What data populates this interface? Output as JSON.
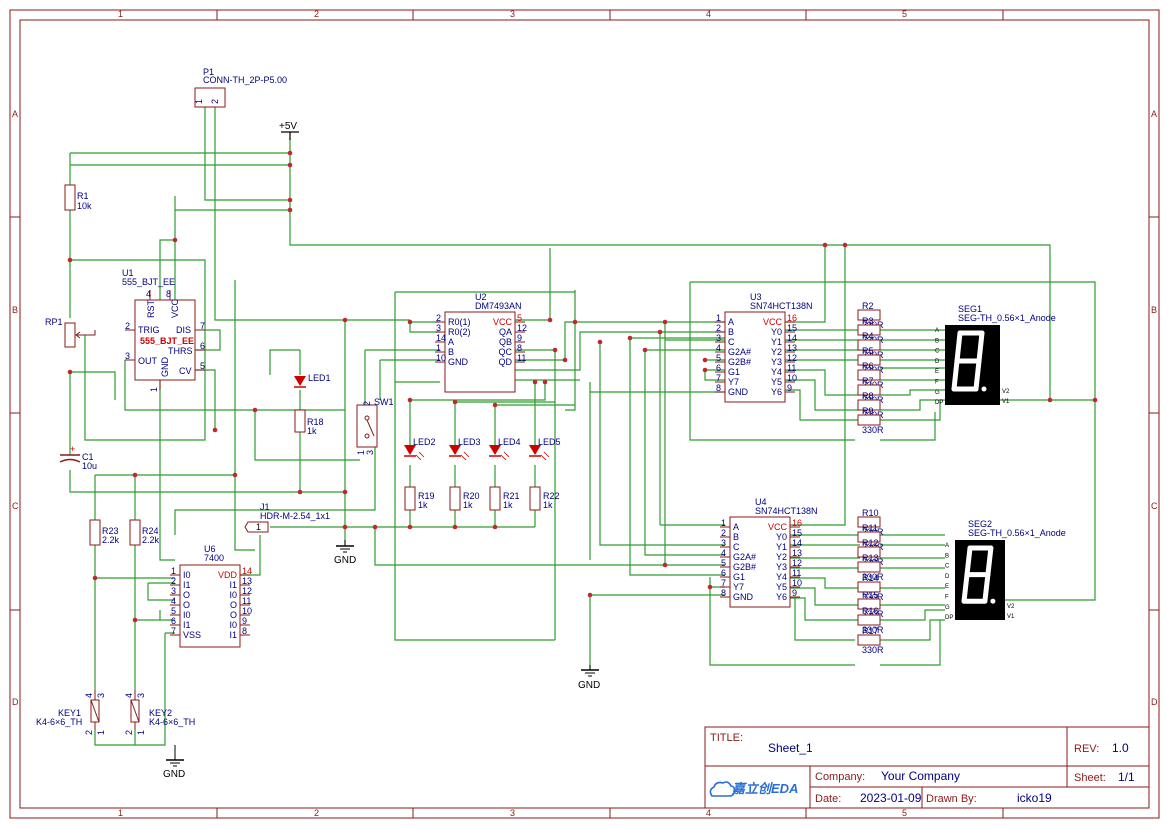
{
  "grid": {
    "cols": [
      "1",
      "2",
      "3",
      "4",
      "5"
    ],
    "rows": [
      "A",
      "B",
      "C",
      "D"
    ]
  },
  "power": {
    "vcc": "+5V",
    "gnd": "GND"
  },
  "components": {
    "P1": {
      "ref": "P1",
      "value": "CONN-TH_2P-P5.00",
      "pins": [
        "1",
        "2"
      ]
    },
    "R1": {
      "ref": "R1",
      "value": "10k"
    },
    "RP1": {
      "ref": "RP1"
    },
    "U1": {
      "ref": "U1",
      "value": "555_BJT_EE",
      "label": "555_BJT_EE",
      "pins": {
        "rst": "RST",
        "vcc": "VCC",
        "trig": "TRIG",
        "dis": "DIS",
        "thrs": "THRS",
        "out": "OUT",
        "cv": "CV",
        "gnd": "GND"
      },
      "nums": {
        "p4": "4",
        "p8": "8",
        "p2": "2",
        "p7": "7",
        "p6": "6",
        "p3": "3",
        "p5": "5",
        "p1": "1"
      }
    },
    "C1": {
      "ref": "C1",
      "value": "10u"
    },
    "LED1": {
      "ref": "LED1"
    },
    "R18": {
      "ref": "R18",
      "value": "1k"
    },
    "SW1": {
      "ref": "SW1",
      "pins": [
        "1",
        "2",
        "3"
      ]
    },
    "U2": {
      "ref": "U2",
      "value": "DM7493AN",
      "left": [
        {
          "n": "2",
          "l": "R0(1)"
        },
        {
          "n": "3",
          "l": "R0(2)"
        },
        {
          "n": "14",
          "l": "A"
        },
        {
          "n": "1",
          "l": "B"
        },
        {
          "n": "10",
          "l": "GND"
        }
      ],
      "right": [
        {
          "n": "5",
          "l": "VCC"
        },
        {
          "n": "12",
          "l": "QA"
        },
        {
          "n": "9",
          "l": "QB"
        },
        {
          "n": "8",
          "l": "QC"
        },
        {
          "n": "11",
          "l": "QD"
        }
      ]
    },
    "LEDS": [
      {
        "ref": "LED2"
      },
      {
        "ref": "LED3"
      },
      {
        "ref": "LED4"
      },
      {
        "ref": "LED5"
      }
    ],
    "RLEDS": [
      {
        "ref": "R19",
        "value": "1k"
      },
      {
        "ref": "R20",
        "value": "1k"
      },
      {
        "ref": "R21",
        "value": "1k"
      },
      {
        "ref": "R22",
        "value": "1k"
      }
    ],
    "J1": {
      "ref": "J1",
      "value": "HDR-M-2.54_1x1",
      "pin": "1"
    },
    "R23": {
      "ref": "R23",
      "value": "2.2k"
    },
    "R24": {
      "ref": "R24",
      "value": "2.2k"
    },
    "U6": {
      "ref": "U6",
      "value": "7400",
      "left": [
        {
          "n": "1",
          "l": "I0"
        },
        {
          "n": "2",
          "l": "I1"
        },
        {
          "n": "3",
          "l": "O"
        },
        {
          "n": "4",
          "l": "O"
        },
        {
          "n": "5",
          "l": "I0"
        },
        {
          "n": "6",
          "l": "I1"
        },
        {
          "n": "7",
          "l": "VSS"
        }
      ],
      "right": [
        {
          "n": "14",
          "l": "VDD"
        },
        {
          "n": "13",
          "l": "I1"
        },
        {
          "n": "12",
          "l": "I0"
        },
        {
          "n": "11",
          "l": "O"
        },
        {
          "n": "10",
          "l": "O"
        },
        {
          "n": "9",
          "l": "I0"
        },
        {
          "n": "8",
          "l": "I1"
        }
      ]
    },
    "KEY1": {
      "ref": "KEY1",
      "value": "K4-6×6_TH",
      "pins": [
        "4",
        "3",
        "2",
        "1"
      ]
    },
    "KEY2": {
      "ref": "KEY2",
      "value": "K4-6×6_TH",
      "pins": [
        "4",
        "3",
        "2",
        "1"
      ]
    },
    "U3": {
      "ref": "U3",
      "value": "SN74HCT138N",
      "left": [
        {
          "n": "1",
          "l": "A"
        },
        {
          "n": "2",
          "l": "B"
        },
        {
          "n": "3",
          "l": "C"
        },
        {
          "n": "4",
          "l": "G2A#"
        },
        {
          "n": "5",
          "l": "G2B#"
        },
        {
          "n": "6",
          "l": "G1"
        },
        {
          "n": "7",
          "l": "Y7"
        },
        {
          "n": "8",
          "l": "GND"
        }
      ],
      "right": [
        {
          "n": "16",
          "l": "VCC"
        },
        {
          "n": "15",
          "l": "Y0"
        },
        {
          "n": "14",
          "l": "Y1"
        },
        {
          "n": "13",
          "l": "Y2"
        },
        {
          "n": "12",
          "l": "Y3"
        },
        {
          "n": "11",
          "l": "Y4"
        },
        {
          "n": "10",
          "l": "Y5"
        },
        {
          "n": "9",
          "l": "Y6"
        }
      ]
    },
    "U4": {
      "ref": "U4",
      "value": "SN74HCT138N",
      "left": [
        {
          "n": "1",
          "l": "A"
        },
        {
          "n": "2",
          "l": "B"
        },
        {
          "n": "3",
          "l": "C"
        },
        {
          "n": "4",
          "l": "G2A#"
        },
        {
          "n": "5",
          "l": "G2B#"
        },
        {
          "n": "6",
          "l": "G1"
        },
        {
          "n": "7",
          "l": "Y7"
        },
        {
          "n": "8",
          "l": "GND"
        }
      ],
      "right": [
        {
          "n": "16",
          "l": "VCC"
        },
        {
          "n": "15",
          "l": "Y0"
        },
        {
          "n": "14",
          "l": "Y1"
        },
        {
          "n": "13",
          "l": "Y2"
        },
        {
          "n": "12",
          "l": "Y3"
        },
        {
          "n": "11",
          "l": "Y4"
        },
        {
          "n": "10",
          "l": "Y5"
        },
        {
          "n": "9",
          "l": "Y6"
        }
      ]
    },
    "RSEG1": [
      {
        "ref": "R2",
        "value": "330R"
      },
      {
        "ref": "R3",
        "value": "330R"
      },
      {
        "ref": "R4",
        "value": "330R"
      },
      {
        "ref": "R5",
        "value": "330R"
      },
      {
        "ref": "R6",
        "value": "330R"
      },
      {
        "ref": "R7",
        "value": "330R"
      },
      {
        "ref": "R8",
        "value": "330R"
      },
      {
        "ref": "R9",
        "value": "330R"
      }
    ],
    "RSEG2": [
      {
        "ref": "R10",
        "value": "330R"
      },
      {
        "ref": "R11",
        "value": "330R"
      },
      {
        "ref": "R12",
        "value": "330R"
      },
      {
        "ref": "R13",
        "value": "330R"
      },
      {
        "ref": "R14",
        "value": "330R"
      },
      {
        "ref": "R15",
        "value": "330R"
      },
      {
        "ref": "R16",
        "value": "330R"
      },
      {
        "ref": "R17",
        "value": "330R"
      }
    ],
    "SEG1": {
      "ref": "SEG1",
      "value": "SEG-TH_0.56×1_Anode",
      "pins_left": [
        "A",
        "B",
        "C",
        "D",
        "E",
        "F",
        "G",
        "DP"
      ],
      "pins_right": [
        "V2",
        "V1"
      ]
    },
    "SEG2": {
      "ref": "SEG2",
      "value": "SEG-TH_0.56×1_Anode",
      "pins_left": [
        "A",
        "B",
        "C",
        "D",
        "E",
        "F",
        "G",
        "DP"
      ],
      "pins_right": [
        "V2",
        "V1"
      ]
    }
  },
  "title_block": {
    "title_label": "TITLE:",
    "title": "Sheet_1",
    "rev_label": "REV:",
    "rev": "1.0",
    "company_label": "Company:",
    "company": "Your Company",
    "sheet_label": "Sheet:",
    "sheet": "1/1",
    "date_label": "Date:",
    "date": "2023-01-09",
    "drawn_label": "Drawn By:",
    "drawn_by": "icko19",
    "logo_text": "嘉立创EDA"
  },
  "colors": {
    "frame": "#8b1a1a",
    "wire": "#2e9c2e",
    "junction": "#c0282d",
    "text": "#000080",
    "pin_red": "#d00000",
    "logo": "#2b6fd6"
  }
}
